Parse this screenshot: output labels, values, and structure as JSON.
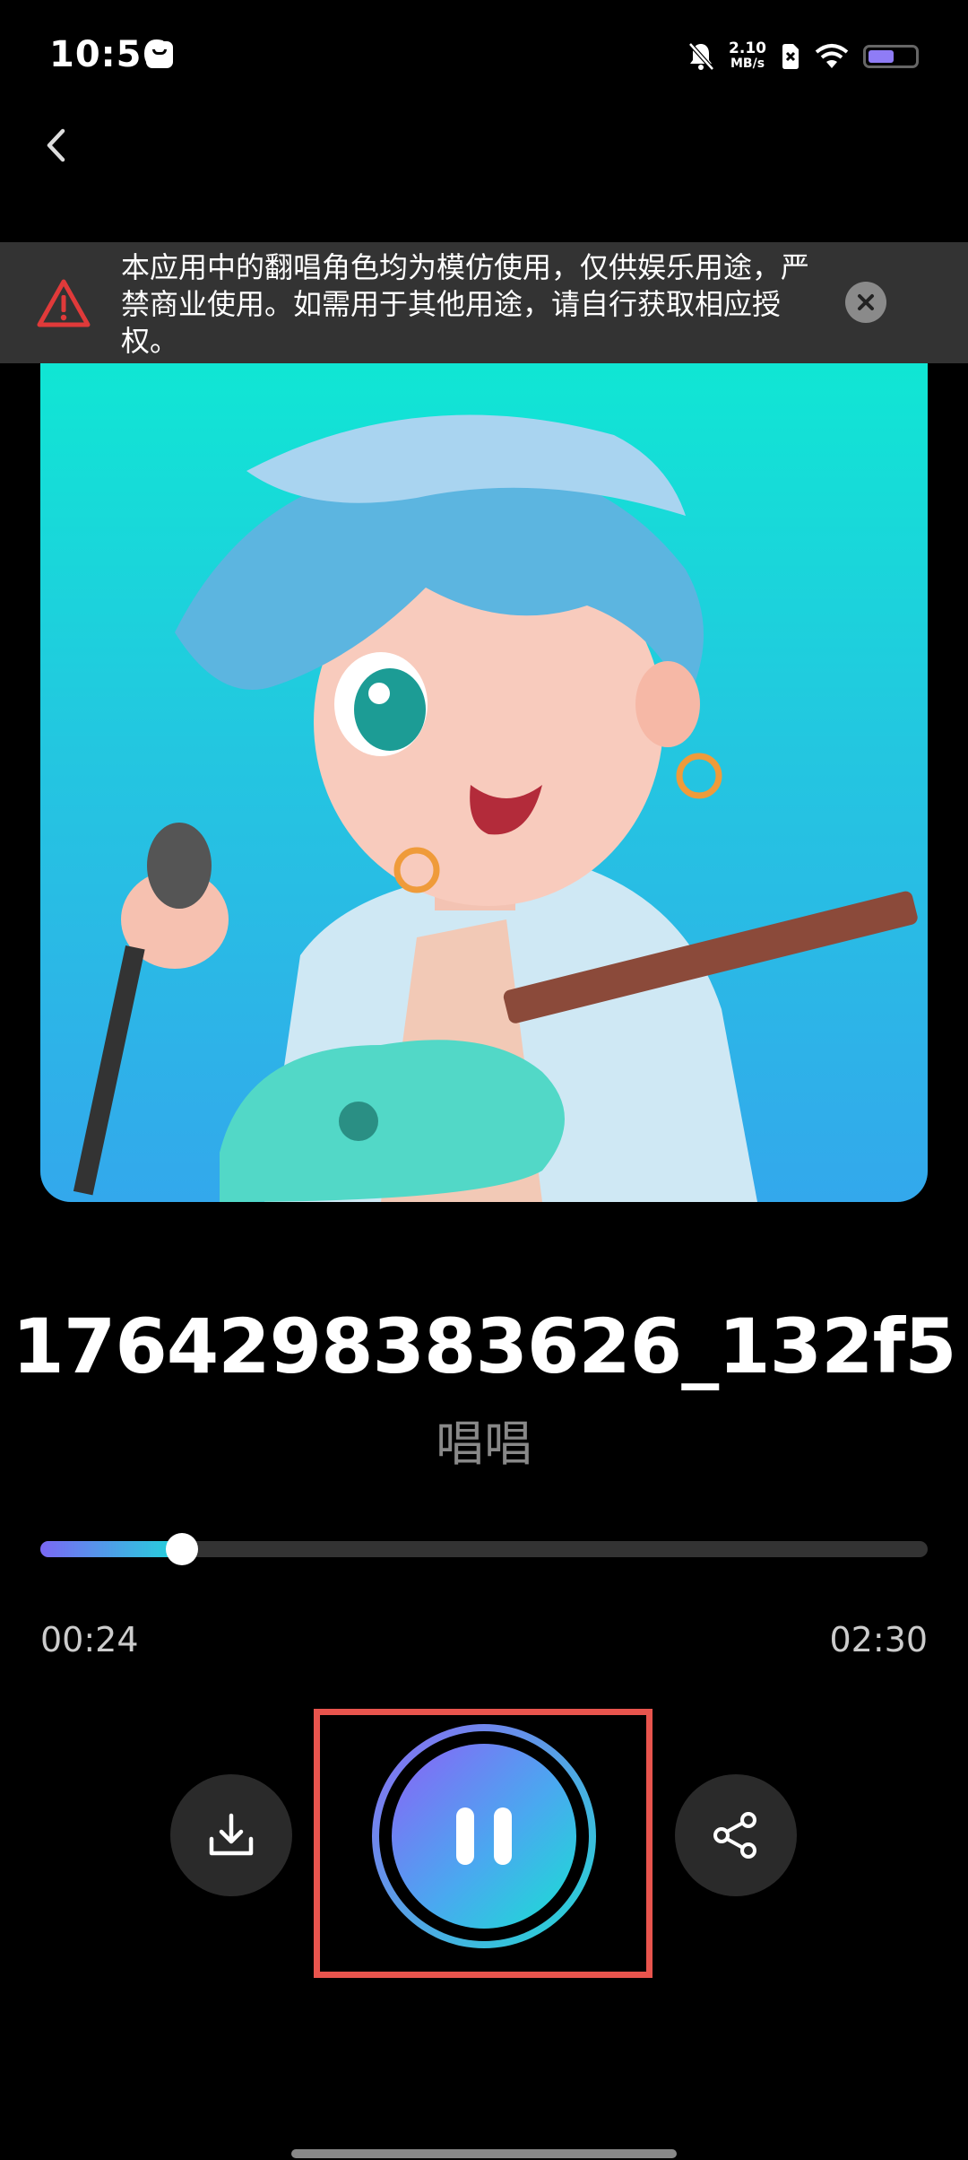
{
  "status_bar": {
    "time": "10:56",
    "net_speed_value": "2.10",
    "net_speed_unit": "MB/s"
  },
  "notice": {
    "text": "本应用中的翻唱角色均为模仿使用，仅供娱乐用途，严禁商业使用。如需用于其他用途，请自行获取相应授权。"
  },
  "song": {
    "title": "1764298383626_132f5",
    "subtitle": "唱唱"
  },
  "player": {
    "current_time": "00:24",
    "total_time": "02:30",
    "progress": 0.16,
    "state": "playing"
  },
  "colors": {
    "accent_start": "#7a68f5",
    "accent_end": "#20d6da",
    "warning_red": "#e03a3a",
    "highlight_box": "#e8544d"
  },
  "icons": [
    "back-arrow-icon",
    "warning-icon",
    "close-icon",
    "download-icon",
    "pause-icon",
    "share-icon"
  ]
}
